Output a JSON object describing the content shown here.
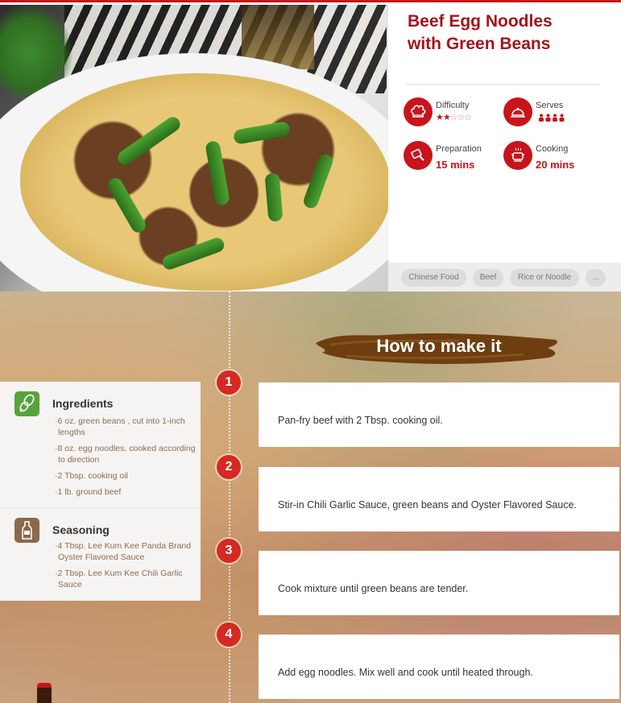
{
  "recipe": {
    "title_line1": "Beef Egg Noodles",
    "title_line2": "with Green Beans",
    "meta": {
      "difficulty": {
        "label": "Difficulty",
        "rating": 2,
        "max": 5
      },
      "serves": {
        "label": "Serves",
        "count": 4
      },
      "preparation": {
        "label": "Preparation",
        "value": "15 mins"
      },
      "cooking": {
        "label": "Cooking",
        "value": "20 mins"
      }
    },
    "tags": [
      "Chinese Food",
      "Beef",
      "Rice or Noodle",
      "..."
    ]
  },
  "howto": {
    "heading": "How to make it"
  },
  "ingredients": {
    "heading": "Ingredients",
    "items": [
      "·6 oz. green beans , cut into 1-inch lengths",
      "·8 oz. egg noodles, cooked according to direction",
      "·2 Tbsp. cooking oil",
      "·1 lb. ground beef"
    ]
  },
  "seasoning": {
    "heading": "Seasoning",
    "items": [
      "·4 Tbsp. Lee Kum Kee Panda Brand Oyster Flavored Sauce",
      "·2 Tbsp. Lee Kum Kee Chili Garlic Sauce"
    ]
  },
  "steps": [
    {
      "number": "1",
      "text": "Pan-fry beef with 2 Tbsp. cooking oil."
    },
    {
      "number": "2",
      "text": "Stir-in Chili Garlic Sauce, green beans and Oyster Flavored Sauce."
    },
    {
      "number": "3",
      "text": "Cook mixture until green beans are tender."
    },
    {
      "number": "4",
      "text": "Add egg noodles. Mix well and cook until heated through."
    }
  ],
  "colors": {
    "brand_red": "#c8141b",
    "title_red": "#a4141c",
    "panel_bg": "#f6f4f2"
  }
}
